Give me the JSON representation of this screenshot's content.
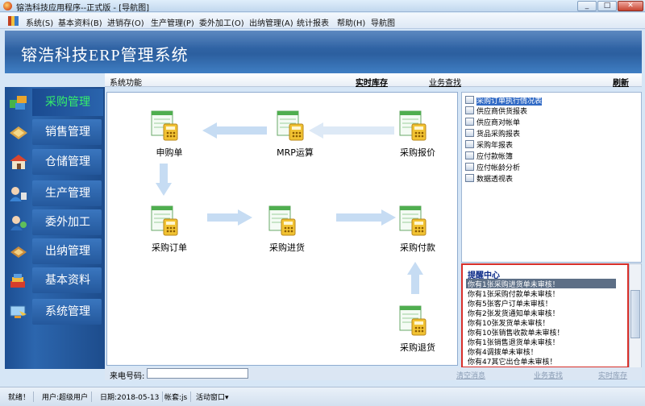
{
  "window": {
    "title": "镕浩科技应用程序--正式版 - [导航图]",
    "minimize": "_",
    "maximize": "□",
    "close": "✕"
  },
  "menu": [
    "系统(S)",
    "基本资料(B)",
    "进销存(O)",
    "生产管理(P)",
    "委外加工(O)",
    "出纳管理(A)",
    "统计报表",
    "帮助(H)",
    "导航图"
  ],
  "banner": {
    "title": "镕浩科技ERP管理系统"
  },
  "nav": {
    "items": [
      {
        "label": "采购管理",
        "icon": "purchase-icon"
      },
      {
        "label": "销售管理",
        "icon": "sales-icon"
      },
      {
        "label": "仓储管理",
        "icon": "warehouse-icon"
      },
      {
        "label": "生产管理",
        "icon": "production-icon"
      },
      {
        "label": "委外加工",
        "icon": "outsource-icon"
      },
      {
        "label": "出纳管理",
        "icon": "cashier-icon"
      },
      {
        "label": "基本资料",
        "icon": "basic-data-icon"
      },
      {
        "label": "系统管理",
        "icon": "system-icon"
      }
    ],
    "active_color": "#35f06a"
  },
  "toolbar": {
    "system_function": "系统功能",
    "realtime_stock": "实时库存",
    "business_query": "业务查找",
    "refresh": "刷新"
  },
  "flow": {
    "nodes": [
      {
        "label": "申购单"
      },
      {
        "label": "MRP运算"
      },
      {
        "label": "采购报价"
      },
      {
        "label": "采购订单"
      },
      {
        "label": "采购进货"
      },
      {
        "label": "采购付款"
      },
      {
        "label": "采购退货"
      }
    ]
  },
  "reports": {
    "items": [
      "采购订单执行情况表",
      "供应商供货报表",
      "供应商对帐单",
      "货品采购报表",
      "采购年报表",
      "应付款帐簿",
      "应付帐龄分析",
      "数据透视表"
    ]
  },
  "reminder": {
    "title": "提醒中心",
    "items": [
      "你有1张采购进货单未审核！",
      "你有1张采购付款单未审核！",
      "你有5张客户订单未审核！",
      "你有2张发货通知单未审核！",
      "你有10张发货单未审核！",
      "你有10张销售收款单未审核！",
      "你有1张销售退货单未审核！",
      "你有4调拨单未审核！",
      "你有47其它出仓单未审核！"
    ]
  },
  "bottom": {
    "phone_label": "来电号码:",
    "phone_value": "",
    "clear_msg": "清空消息",
    "business_query": "业务查找",
    "realtime_stock": "实时库存"
  },
  "status": {
    "ready": "就绪！",
    "user": "用户:超级用户",
    "date": "日期:2018-05-13",
    "account": "帐套:js",
    "active_window": "活动窗口▾"
  },
  "colors": {
    "banner": "#2c5f9f",
    "nav": "#1c4e92",
    "highlight": "#d9302a",
    "arrow": "#b9d4f1"
  }
}
